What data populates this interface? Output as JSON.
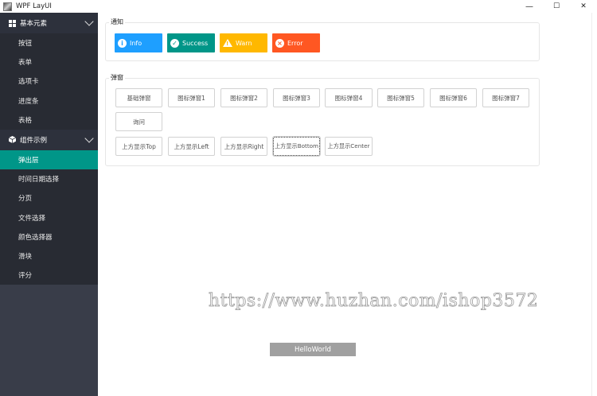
{
  "window": {
    "title": "WPF LayUI",
    "controls": [
      "—",
      "☐",
      "✕"
    ]
  },
  "sidebar": {
    "groups": [
      {
        "label": "基本元素",
        "icon": "grid-icon",
        "items": [
          "按钮",
          "表单",
          "选项卡",
          "进度条",
          "表格"
        ]
      },
      {
        "label": "组件示例",
        "icon": "cube-icon",
        "items": [
          "弹出层",
          "时间日期选择",
          "分页",
          "文件选择",
          "颜色选择器",
          "滑块",
          "评分"
        ],
        "active_index": 0
      }
    ]
  },
  "notice": {
    "title": "通知",
    "buttons": [
      {
        "label": "Info",
        "icon": "i",
        "color": "#1e9fff"
      },
      {
        "label": "Success",
        "icon": "✓",
        "color": "#009688"
      },
      {
        "label": "Warn",
        "icon": "!",
        "color": "#ffb800"
      },
      {
        "label": "Error",
        "icon": "×",
        "color": "#ff5722"
      }
    ]
  },
  "popup": {
    "title": "弹窗",
    "row1": [
      "基础弹窗",
      "图标弹窗1",
      "图标弹窗2",
      "图标弹窗3",
      "图标弹窗4",
      "图标弹窗5",
      "图标弹窗6",
      "图标弹窗7"
    ],
    "row2": [
      "询问"
    ],
    "row3": [
      "上方显示Top",
      "上方显示Left",
      "上方显示Right",
      "上方显示Bottom",
      "上方显示Center"
    ]
  },
  "toast": {
    "label": "HelloWorld"
  },
  "watermark": {
    "text": "https://www.huzhan.com/ishop3572"
  }
}
